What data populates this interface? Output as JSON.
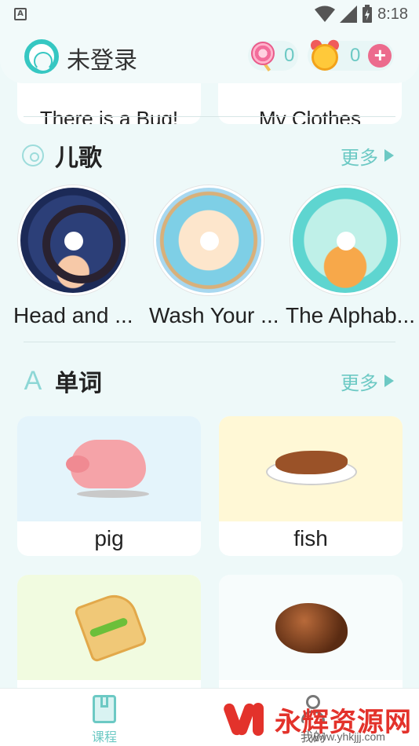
{
  "status_bar": {
    "app_indicator": "A",
    "time": "8:18"
  },
  "header": {
    "login_status": "未登录",
    "candy_count": "0",
    "clock_count": "0",
    "plus_symbol": "+"
  },
  "previous_row": {
    "left_title": "There is a Bug!",
    "right_title": "My Clothes"
  },
  "songs_section": {
    "title": "儿歌",
    "more": "更多",
    "items": [
      {
        "name": "Head and ..."
      },
      {
        "name": "Wash Your ..."
      },
      {
        "name": "The Alphab..."
      }
    ]
  },
  "words_section": {
    "title": "单词",
    "more": "更多",
    "items": [
      {
        "word": "pig"
      },
      {
        "word": "fish"
      },
      {
        "word": ""
      },
      {
        "word": ""
      }
    ]
  },
  "bottom_nav": {
    "courses": "课程",
    "mine": "我的"
  },
  "watermark": {
    "brand": "永辉资源网",
    "url": "www.yhkjjj.com"
  },
  "colors": {
    "accent": "#6cc9c4",
    "plus": "#ec6b8d",
    "watermark": "#e3322b"
  }
}
